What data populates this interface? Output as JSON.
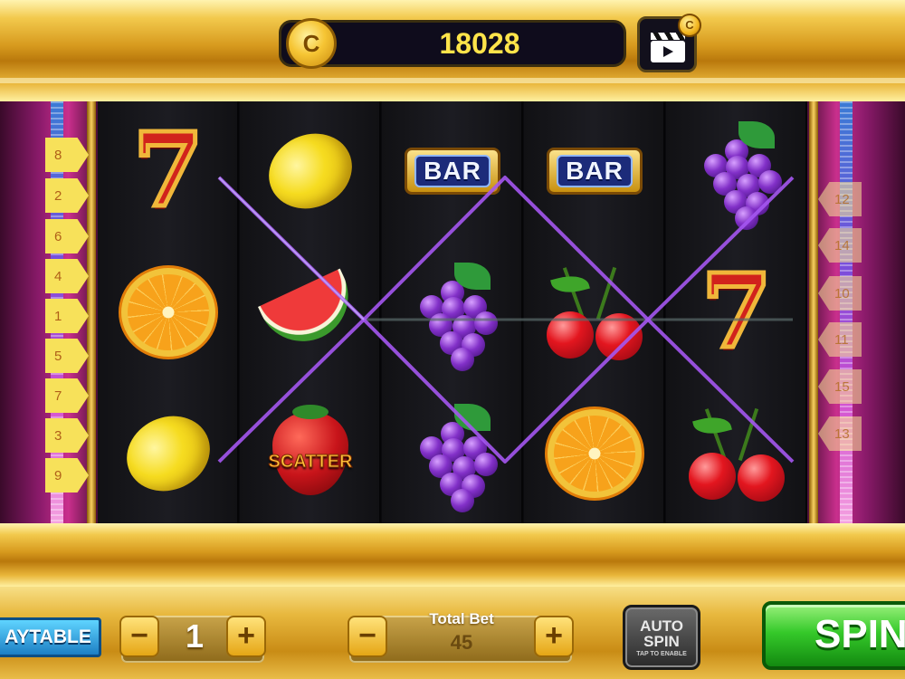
{
  "header": {
    "balance": "18028",
    "coin_icon": "coin-icon",
    "coin_glyph": "C",
    "video_bonus_icon": "video-clapper-icon"
  },
  "paylines": {
    "left": [
      "8",
      "2",
      "6",
      "4",
      "1",
      "5",
      "7",
      "3",
      "9"
    ],
    "right": [
      "12",
      "14",
      "10",
      "11",
      "15",
      "13"
    ]
  },
  "reels": [
    [
      "seven",
      "orange",
      "lemon"
    ],
    [
      "lemon",
      "watermelon",
      "scatter"
    ],
    [
      "bar",
      "grapes",
      "grapes"
    ],
    [
      "bar",
      "cherries",
      "orange"
    ],
    [
      "grapes",
      "seven",
      "cherries"
    ]
  ],
  "symbols": {
    "seven_glyph": "7",
    "bar_label": "BAR",
    "scatter_label": "SCATTER"
  },
  "controls": {
    "paytable_label": "AYTABLE",
    "lines_minus": "−",
    "lines_value": "1",
    "lines_plus": "+",
    "total_bet_label": "Total Bet",
    "total_bet_value": "45",
    "bet_minus": "−",
    "bet_plus": "+",
    "auto_spin_line1": "AUTO",
    "auto_spin_line2": "SPIN",
    "auto_spin_hint": "TAP TO ENABLE",
    "spin_label": "SPIN"
  },
  "colors": {
    "gold": "#e2a92a",
    "payline": "#9a4ee6",
    "balance_text": "#ffe44a",
    "spin_green": "#35c92a",
    "paytable_blue": "#1d7fc4"
  }
}
